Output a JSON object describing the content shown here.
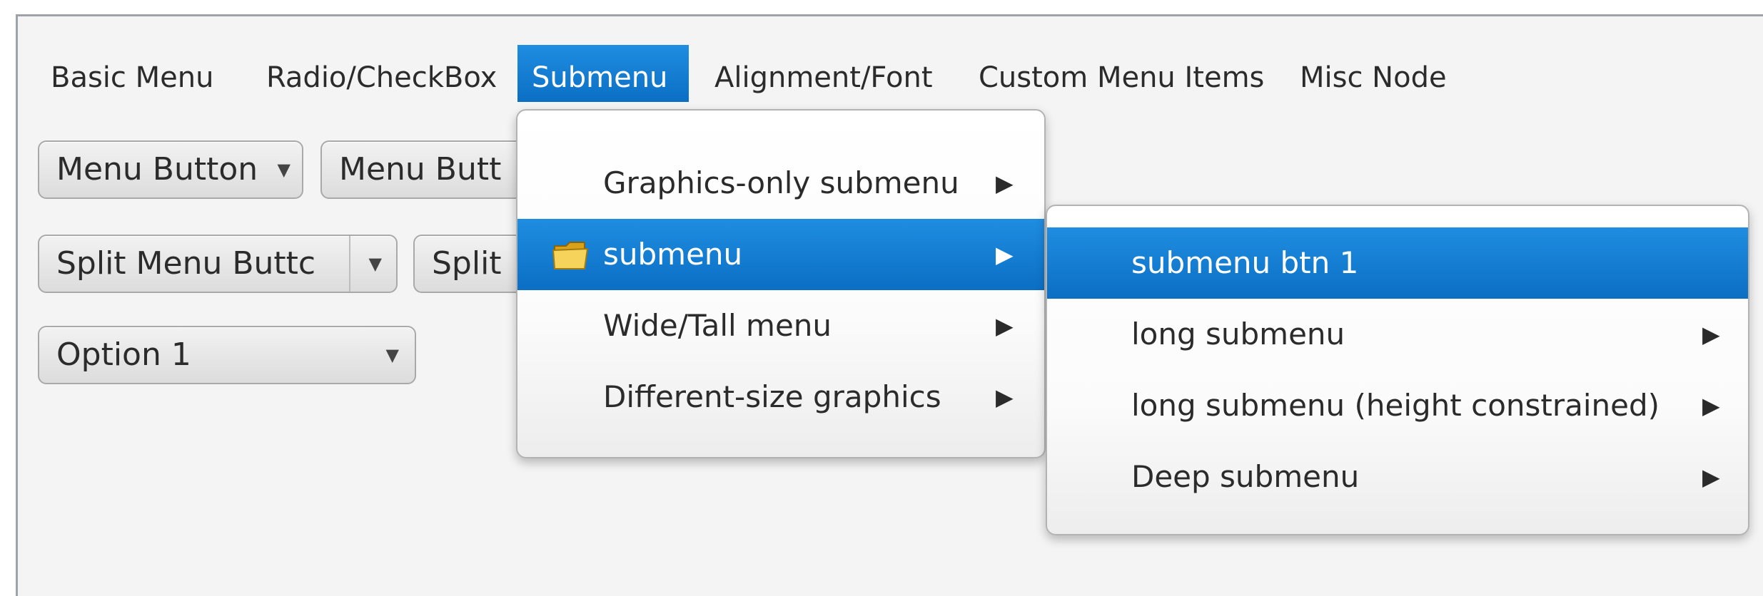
{
  "menubar": {
    "items": [
      {
        "label": "Basic Menu"
      },
      {
        "label": "Radio/CheckBox"
      },
      {
        "label": "Submenu"
      },
      {
        "label": "Alignment/Font"
      },
      {
        "label": "Custom Menu Items"
      },
      {
        "label": "Misc Node"
      }
    ],
    "active": "Submenu"
  },
  "controls": {
    "menu_button_1": "Menu Button",
    "menu_button_2": "Menu Butt",
    "split_button_1": "Split Menu Buttc",
    "split_button_2": "Split",
    "choice_box": "Option 1"
  },
  "submenu_popup": {
    "items": [
      {
        "label": "Graphics-only submenu",
        "has_submenu": true
      },
      {
        "label": "submenu",
        "has_submenu": true,
        "icon": "folder-icon",
        "selected": true
      },
      {
        "label": "Wide/Tall menu",
        "has_submenu": true
      },
      {
        "label": "Different-size graphics",
        "has_submenu": true
      }
    ]
  },
  "nested_popup": {
    "items": [
      {
        "label": "submenu btn 1",
        "has_submenu": false,
        "selected": true
      },
      {
        "label": "long submenu",
        "has_submenu": true
      },
      {
        "label": "long submenu (height constrained)",
        "has_submenu": true
      },
      {
        "label": "Deep submenu",
        "has_submenu": true
      }
    ]
  },
  "glyphs": {
    "submenu_arrow": "▶",
    "dropdown_arrow": "▼"
  },
  "colors": {
    "selection": "#1479d3",
    "window_bg": "#f4f4f4"
  }
}
